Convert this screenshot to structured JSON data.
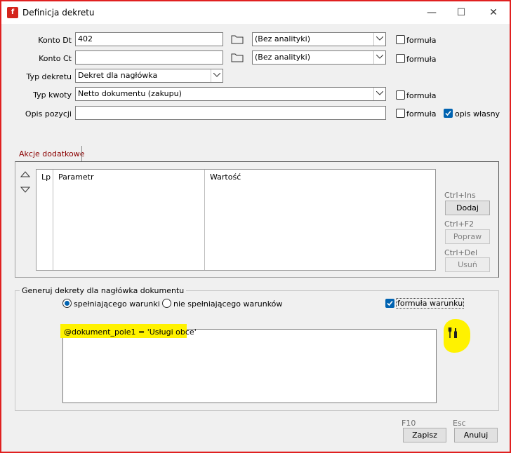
{
  "window": {
    "title": "Definicja dekretu",
    "minimize_glyph": "—",
    "maximize_glyph": "☐",
    "close_glyph": "✕"
  },
  "form": {
    "konto_dt": {
      "label": "Konto Dt",
      "value": "402",
      "analytics": "(Bez analityki)",
      "formula_label": "formuła"
    },
    "konto_ct": {
      "label": "Konto Ct",
      "value": "",
      "analytics": "(Bez analityki)",
      "formula_label": "formuła"
    },
    "typ_dekretu": {
      "label": "Typ dekretu",
      "value": "Dekret dla nagłówka"
    },
    "typ_kwoty": {
      "label": "Typ kwoty",
      "value": "Netto dokumentu (zakupu)",
      "formula_label": "formuła"
    },
    "opis_pozycji": {
      "label": "Opis pozycji",
      "value": "",
      "formula_label": "formuła",
      "own_desc_label": "opis własny"
    }
  },
  "tabs": {
    "akcje": "Akcje dodatkowe"
  },
  "grid": {
    "columns": [
      "Lp",
      "Parametr",
      "Wartość"
    ],
    "rows": []
  },
  "side_buttons": {
    "dodaj": {
      "hint": "Ctrl+Ins",
      "label": "Dodaj"
    },
    "popraw": {
      "hint": "Ctrl+F2",
      "label": "Popraw"
    },
    "usun": {
      "hint": "Ctrl+Del",
      "label": "Usuń"
    }
  },
  "generate": {
    "title": "Generuj dekrety dla nagłówka dokumentu",
    "option_meet": "spełniającego warunki",
    "option_not_meet": "nie spełniającego warunków",
    "formula_condition_label": "formuła warunku",
    "condition_text": "@dokument_pole1 = 'Usługi obce'"
  },
  "footer": {
    "save": {
      "hint": "F10",
      "label": "Zapisz"
    },
    "cancel": {
      "hint": "Esc",
      "label": "Anuluj"
    }
  },
  "colors": {
    "accent": "#0063b1",
    "tab_text": "#8b0000",
    "highlight": "#fff200",
    "frame": "#e02020"
  }
}
